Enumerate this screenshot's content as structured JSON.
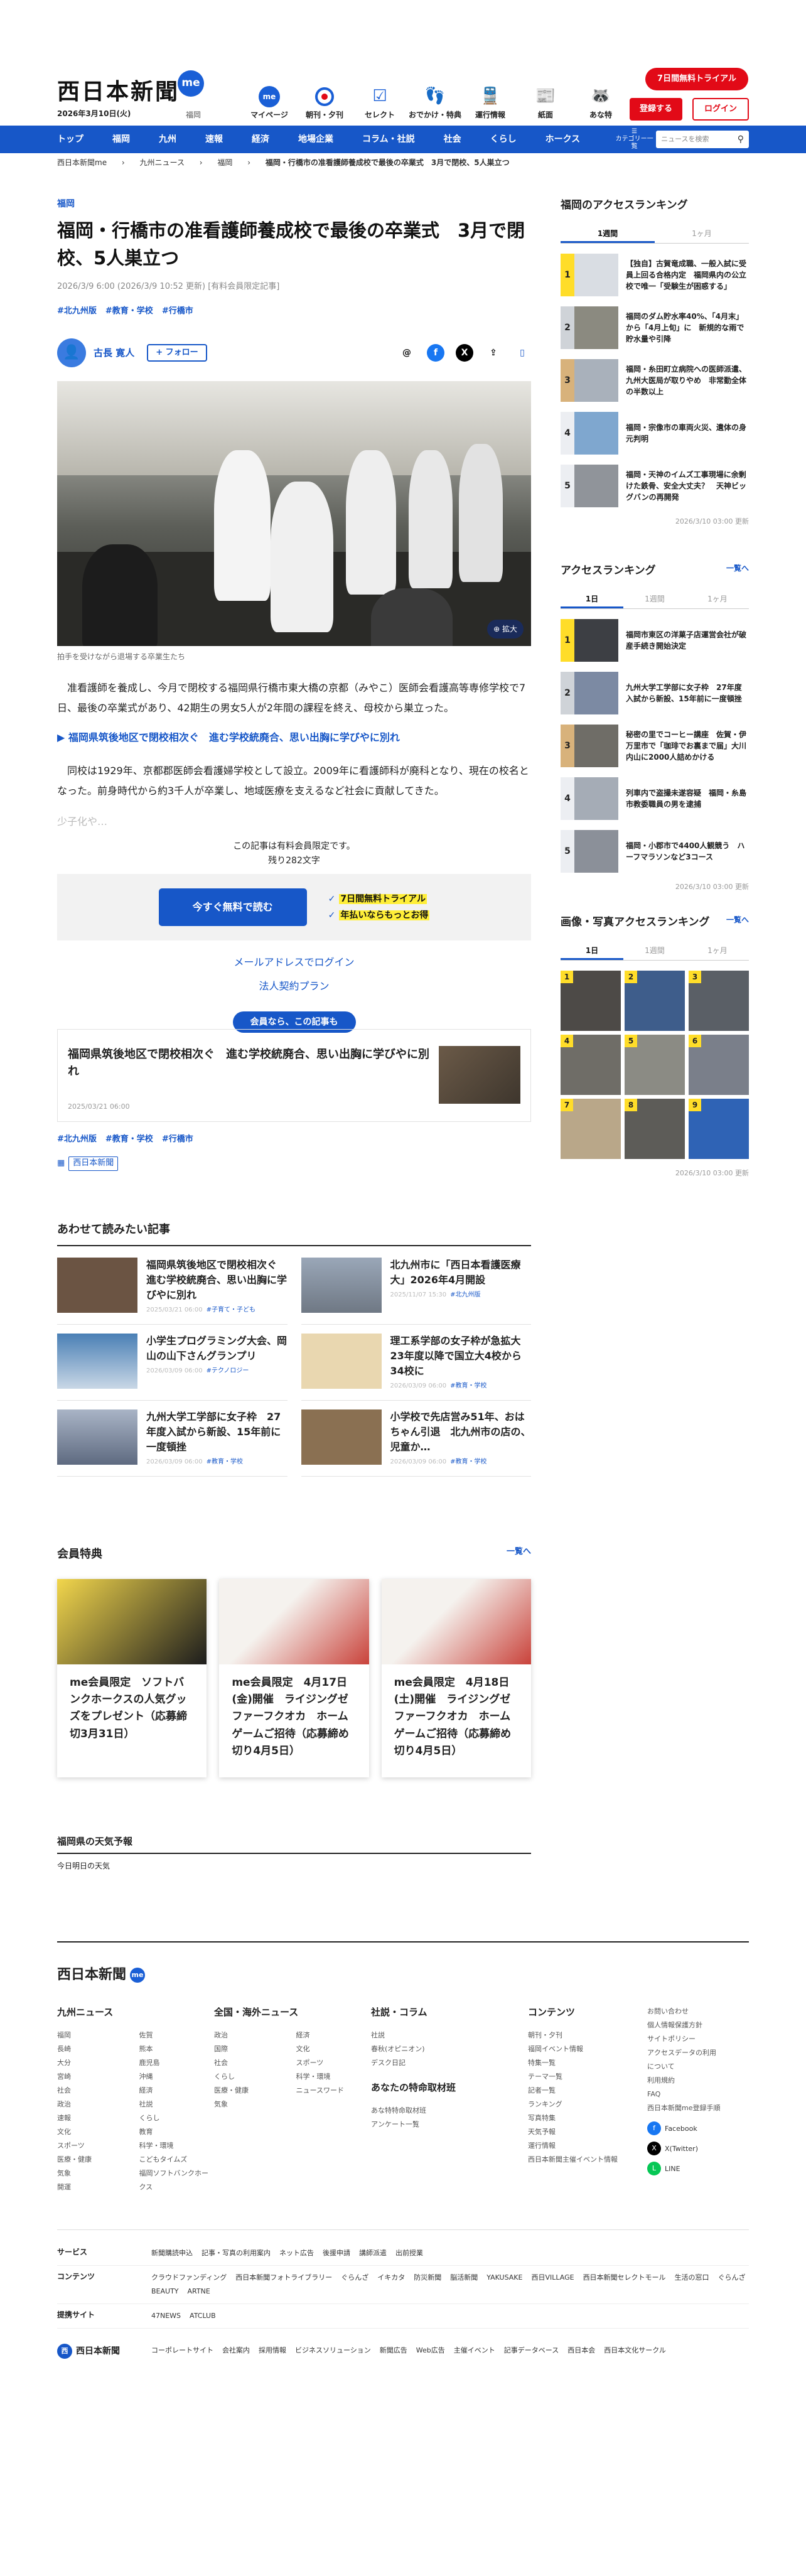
{
  "header": {
    "logo": "西日本新聞",
    "logo_me": "me",
    "date": "2026年3月10日(火)",
    "region": "福岡",
    "nav": [
      {
        "label": "マイページ",
        "icon": "me-icon"
      },
      {
        "label": "朝刊・夕刊",
        "icon": "newspaper-icon"
      },
      {
        "label": "セレクト",
        "icon": "select-icon"
      },
      {
        "label": "おでかけ・特典",
        "icon": "footprints-icon"
      },
      {
        "label": "運行情報",
        "icon": "train-icon"
      },
      {
        "label": "紙面",
        "icon": "paper-icon"
      },
      {
        "label": "あな特",
        "icon": "raccoon-icon"
      }
    ],
    "trial_button": "7日間無料トライアル",
    "register_button": "登録する",
    "login_button": "ログイン"
  },
  "main_nav": {
    "items": [
      "トップ",
      "福岡",
      "九州",
      "速報",
      "経済",
      "地場企業",
      "コラム・社説",
      "社会",
      "くらし",
      "ホークス"
    ],
    "category_label": "カテゴリー一覧",
    "search_placeholder": "ニュースを検索"
  },
  "breadcrumb": [
    "西日本新聞me",
    "九州ニュース",
    "福岡",
    "福岡・行橋市の准看護師養成校で最後の卒業式　3月で閉校、5人巣立つ"
  ],
  "article": {
    "category": "福岡",
    "title": "福岡・行橋市の准看護師養成校で最後の卒業式　3月で閉校、5人巣立つ",
    "meta": "2026/3/9 6:00 (2026/3/9 10:52 更新) [有料会員限定記事]",
    "tags": [
      "#北九州版",
      "#教育・学校",
      "#行橋市"
    ],
    "author": "古長 寛人",
    "follow": "+ フォロー",
    "photo_zoom": "拡大",
    "photo_caption": "拍手を受けながら退場する卒業生たち",
    "paragraphs": [
      "准看護師を養成し、今月で閉校する福岡県行橋市東大橋の京都（みやこ）医師会看護高等専修学校で7日、最後の卒業式があり、42期生の男女5人が2年間の課程を終え、母校から巣立った。",
      "同校は1929年、京都郡医師会看護婦学校として設立。2009年に看護師科が廃科となり、現在の校名となった。前身時代から約3千人が卒業し、地域医療を支えるなど社会に貢献してきた。"
    ],
    "related_link": "福岡県筑後地区で閉校相次ぐ　進む学校統廃合、思い出胸に学びやに別れ",
    "fade_text": "少子化や…",
    "paywall_note": "この記事は有料会員限定です。",
    "paywall_remaining": "残り282文字",
    "read_free_button": "今すぐ無料で読む",
    "paywall_points": [
      "7日間無料トライアル",
      "年払いならもっとお得"
    ],
    "mail_login": "メールアドレスでログイン",
    "corporate_plan": "法人契約プラン",
    "members_label": "会員なら、この記事も",
    "members_article": {
      "title": "福岡県筑後地区で閉校相次ぐ　進む学校統廃合、思い出胸に学びやに別れ",
      "date": "2025/03/21 06:00"
    },
    "bottom_tags": [
      "#北九州版",
      "#教育・学校",
      "#行橋市"
    ],
    "publisher": "西日本新聞"
  },
  "recommended": {
    "heading": "あわせて読みたい記事",
    "items": [
      {
        "title": "福岡県筑後地区で閉校相次ぐ　進む学校統廃合、思い出胸に学びやに別れ",
        "date": "2025/03/21 06:00",
        "tag": "#子育て・子ども",
        "color": "#6b5443"
      },
      {
        "title": "北九州市に「西日本看護医療大」2026年4月開設",
        "date": "2025/11/07 15:30",
        "tag": "#北九州版",
        "color": "#8a8f98"
      },
      {
        "title": "小学生プログラミング大会、岡山の山下さんグランプリ",
        "date": "2026/03/09 06:00",
        "tag": "#テクノロジー",
        "color": "#4a7fb5"
      },
      {
        "title": "理工系学部の女子枠が急拡大　23年度以降で国立大4校から34校に",
        "date": "2026/03/09 06:00",
        "tag": "#教育・学校",
        "color": "#e9d7b0"
      },
      {
        "title": "九州大学工学部に女子枠　27年度入試から新設、15年前に一度頓挫",
        "date": "2026/03/09 06:00",
        "tag": "#教育・学校",
        "color": "#7c8aa3"
      },
      {
        "title": "小学校で先店営み51年、おはちゃん引退　北九州市の店の、児童か…",
        "date": "2026/03/09 06:00",
        "tag": "#教育・学校",
        "color": "#8a7052"
      }
    ]
  },
  "benefits": {
    "heading": "会員特典",
    "more": "一覧へ",
    "items": [
      {
        "title": "me会員限定　ソフトバンクホークスの人気グッズをプレゼント（応募締切3月31日）",
        "color": "#e9c94a"
      },
      {
        "title": "me会員限定　4月17日(金)開催　ライジングゼファーフクオカ　ホームゲームご招待（応募締め切り4月5日）",
        "color": "#c9423a"
      },
      {
        "title": "me会員限定　4月18日(土)開催　ライジングゼファーフクオカ　ホームゲームご招待（応募締め切り4月5日）",
        "color": "#c9423a"
      }
    ]
  },
  "weather": {
    "heading": "福岡県の天気予報",
    "tab": "今日明日の天気"
  },
  "sidebar": {
    "local_ranking": {
      "heading": "福岡のアクセスランキング",
      "tabs": [
        "1週間",
        "1ヶ月"
      ],
      "items": [
        "【独自】古賀竜成職、一般入試に受員上回る合格内定　福岡県内の公立校で唯一「受験生が困惑する」",
        "福岡のダム貯水率40%、「4月末」から「4月上旬」に　新規的な雨で貯水量や引降",
        "福岡・糸田町立病院への医師派遣、九州大医局が取りやめ　非常勤全体の半数以上",
        "福岡・宗像市の車両火災、遺体の身元判明",
        "福岡・天神のイムズ工事現場に余剰けた鉄骨、安全大丈夫？　天神ビッグバンの再開発"
      ],
      "updated": "2026/3/10 03:00 更新"
    },
    "access_ranking": {
      "heading": "アクセスランキング",
      "more": "一覧へ",
      "tabs": [
        "1日",
        "1週間",
        "1ヶ月"
      ],
      "items": [
        "福岡市東区の洋菓子店運営会社が破産手続き開始決定",
        "九州大学工学部に女子枠　27年度入試から新設、15年前に一度頓挫",
        "秘密の里でコーヒー講座　佐賀・伊万里市で「珈琲でお裏まで届」大川内山に2000人詰めかける",
        "列車内で盗撮未遂容疑　福岡・糸島市教委職員の男を逮捕",
        "福岡・小郡市で4400人観競う　ハーフマラソンなど3コース"
      ],
      "updated": "2026/3/10 03:00 更新"
    },
    "photo_ranking": {
      "heading": "画像・写真アクセスランキング",
      "more": "一覧へ",
      "tabs": [
        "1日",
        "1週間",
        "1ヶ月"
      ],
      "colors": [
        "#4d4a47",
        "#3e5d8b",
        "#5a5f66",
        "#6f6d67",
        "#8b8b84",
        "#7a7f8a",
        "#b9a789",
        "#5d5c58",
        "#2f63b5"
      ],
      "updated": "2026/3/10 03:00 更新"
    }
  },
  "footer": {
    "logo": "西日本新聞",
    "logo_me": "me",
    "columns": [
      {
        "heading": "九州ニュース",
        "items": [
          "福岡",
          "長崎",
          "大分",
          "宮崎",
          "社会",
          "政治",
          "速報",
          "文化",
          "スポーツ",
          "医療・健康",
          "気象",
          "開運",
          "佐賀",
          "熊本",
          "鹿児島",
          "沖縄",
          "経済",
          "社説",
          "くらし",
          "教育",
          "科学・環境",
          "こどもタイムズ",
          "福岡ソフトバンクホークス"
        ]
      },
      {
        "heading": "全国・海外ニュース",
        "items": [
          "政治",
          "国際",
          "社会",
          "くらし",
          "医療・健康",
          "気象",
          "経済",
          "文化",
          "スポーツ",
          "科学・環境",
          "ニュースワード"
        ]
      },
      {
        "heading": "社説・コラム",
        "items": [
          "社説",
          "春秋(オピニオン)",
          "デスク日記"
        ],
        "sub_heading": "あなたの特命取材班",
        "sub_items": [
          "あな特特命取材班",
          "アンケート一覧"
        ]
      },
      {
        "heading": "コンテンツ",
        "items": [
          "朝刊・夕刊",
          "福岡イベント情報",
          "特集一覧",
          "テーマ一覧",
          "記者一覧",
          "ランキング",
          "写真特集",
          "天気予報",
          "運行情報",
          "西日本新聞主催イベント情報"
        ]
      }
    ],
    "side_links": [
      "お問い合わせ",
      "個人情報保護方針",
      "サイトポリシー",
      "アクセスデータの利用について",
      "利用規約",
      "FAQ",
      "西日本新聞me登録手順"
    ],
    "social": [
      {
        "label": "Facebook",
        "icon": "facebook-icon"
      },
      {
        "label": "X(Twitter)",
        "icon": "x-icon"
      },
      {
        "label": "LINE",
        "icon": "line-icon"
      }
    ],
    "link_rows": [
      {
        "label": "サービス",
        "items": [
          "新聞購読申込",
          "記事・写真の利用案内",
          "ネット広告",
          "後援申請",
          "講師派遣",
          "出前授業"
        ]
      },
      {
        "label": "コンテンツ",
        "items": [
          "クラウドファンディング",
          "西日本新聞フォトライブラリー",
          "ぐらんざ",
          "イキカタ",
          "防災新聞",
          "脳活新聞",
          "YAKUSAKE",
          "西日VILLAGE",
          "西日本新聞セレクトモール",
          "生活の窓口",
          "ぐらんざBEAUTY",
          "ARTNE"
        ]
      },
      {
        "label": "提携サイト",
        "items": [
          "47NEWS",
          "ATCLUB"
        ]
      }
    ],
    "bottom_logo": "西日本新聞",
    "bottom_links": [
      "コーポレートサイト",
      "会社案内",
      "採用情報",
      "ビジネスソリューション",
      "新聞広告",
      "Web広告",
      "主催イベント",
      "記事データベース",
      "西日本会",
      "西日本文化サークル"
    ]
  }
}
